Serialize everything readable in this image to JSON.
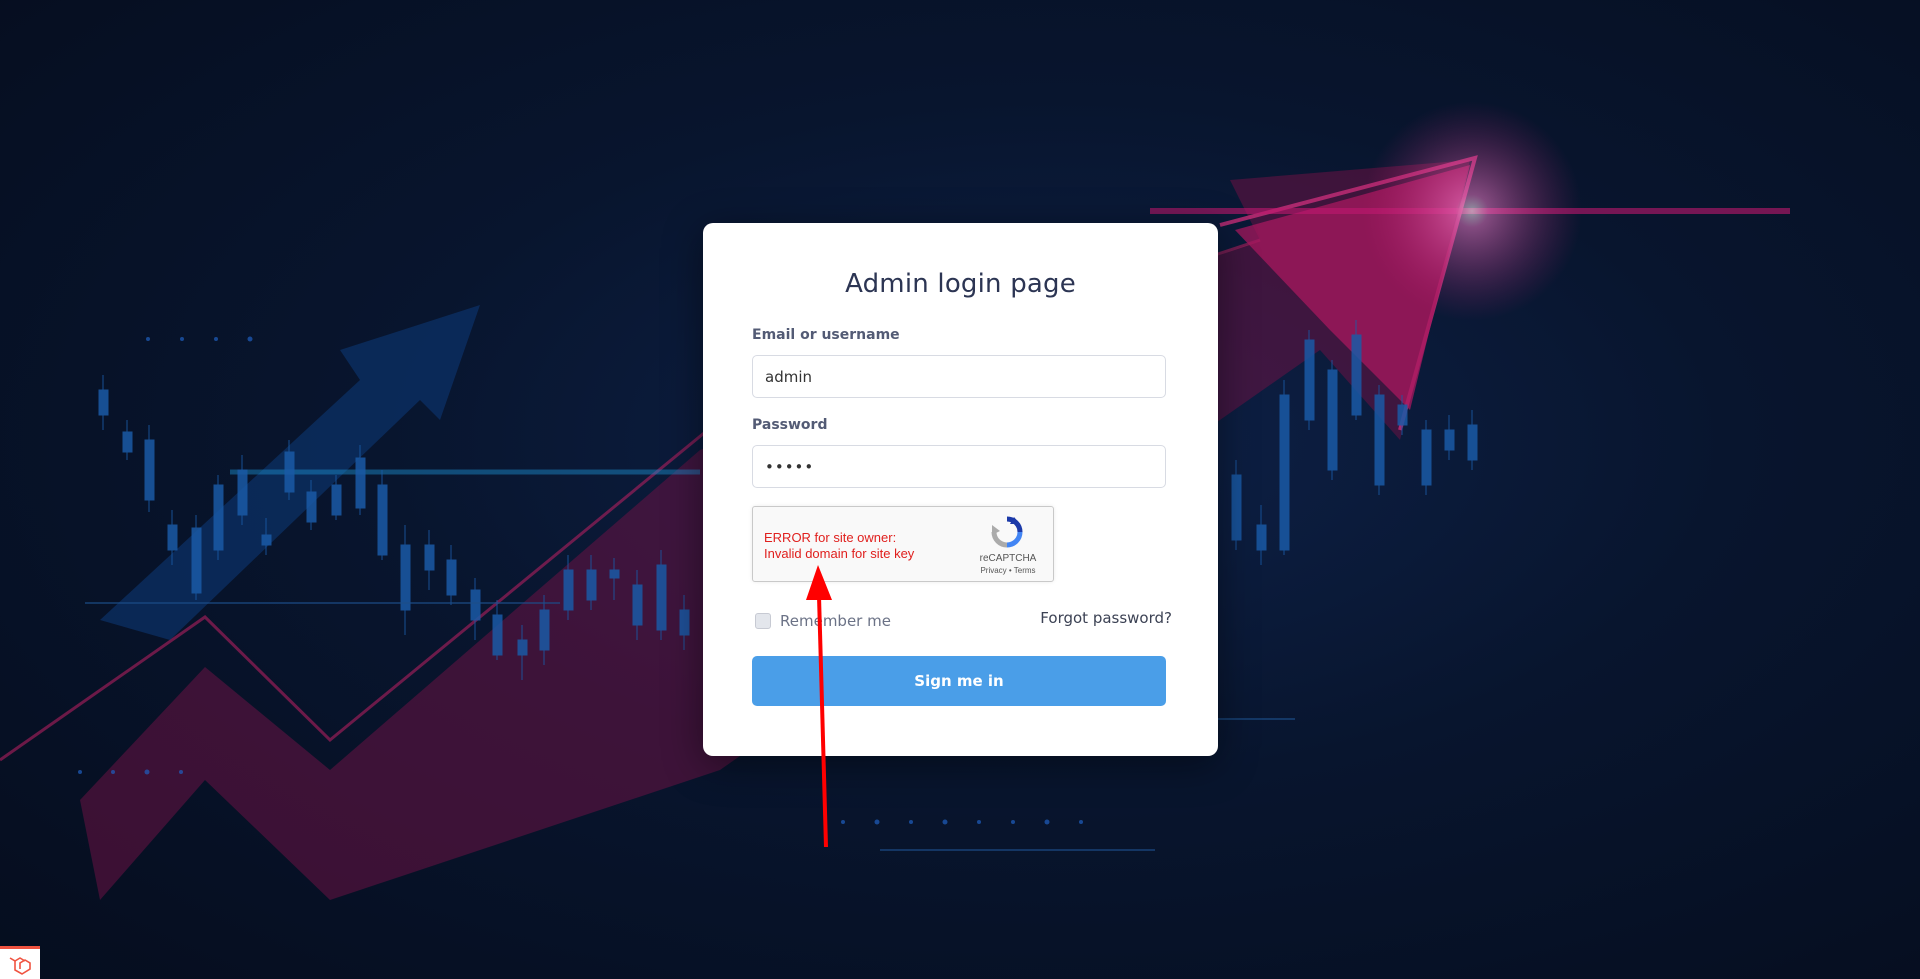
{
  "login": {
    "title": "Admin login page",
    "username_label": "Email or username",
    "username_value": "admin",
    "password_label": "Password",
    "password_value": "•••••",
    "captcha": {
      "error_line1": "ERROR for site owner:",
      "error_line2": "Invalid domain for site key",
      "brand": "reCAPTCHA",
      "links": "Privacy • Terms"
    },
    "remember_label": "Remember me",
    "forgot_label": "Forgot password?",
    "submit_label": "Sign me in"
  },
  "icons": {
    "recaptcha": "recaptcha-logo-icon",
    "corner": "laravel-logo-icon",
    "annotation": "red-arrow-annotation"
  },
  "colors": {
    "button": "#4a9ee8",
    "error": "#e0201e",
    "arrow": "#ff0000",
    "background": "#08152e",
    "accent_magenta": "#c0186f"
  }
}
